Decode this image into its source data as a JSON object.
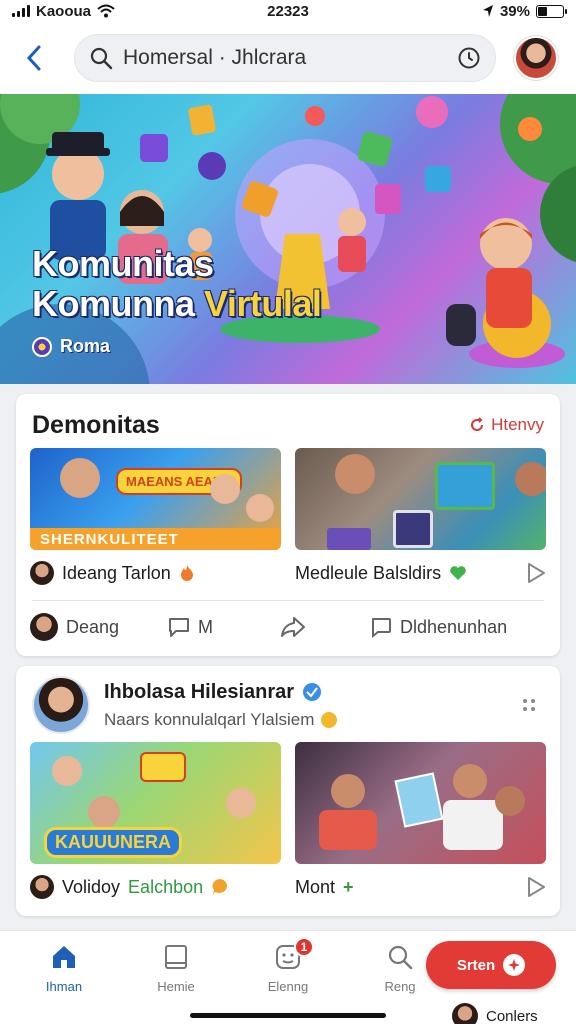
{
  "status_bar": {
    "carrier": "Kaooua",
    "time": "22323",
    "battery": "39%",
    "battery_level": 0.39
  },
  "header": {
    "search_text": "Homersal · Jhlcrara",
    "search_icon": "search-icon",
    "timer_icon": "clock-icon"
  },
  "hero": {
    "title_line1": "Komunitas",
    "title_line2_a": "Komunna ",
    "title_line2_b": "Virtulal",
    "badge": "Roma",
    "colors": {
      "accent": "#f7d43a",
      "outline": "#1b2a6b"
    }
  },
  "featured": {
    "title": "Demonitas",
    "link_label": "Htenvy",
    "thumb1_caption": "SHERNKULITEET",
    "thumb1_banner": "MAEANS AEANA",
    "items": [
      {
        "label": "Ideang Tarlon"
      },
      {
        "label": "Medleule Balsldirs"
      }
    ],
    "actions": {
      "author": "Deang",
      "comment": "M",
      "forward": "",
      "discuss": "Dldhenunhan"
    }
  },
  "post": {
    "name": "Ihbolasa Hilesianrar",
    "subtitle": "Naars konnulalqarl Ylalsiem",
    "thumb3_banner": "KAUUUNERA",
    "items": [
      {
        "label": "Volidoy",
        "tag": "Ealchbon"
      },
      {
        "label": "Mont",
        "tag": "+"
      }
    ]
  },
  "bottom_nav": {
    "items": [
      {
        "label": "Ihman",
        "icon": "home-icon"
      },
      {
        "label": "Hemie",
        "icon": "book-icon"
      },
      {
        "label": "Elenng",
        "icon": "chat-icon",
        "badge": "1"
      },
      {
        "label": "Reng",
        "icon": "search-icon"
      }
    ],
    "cta_label": "Srten",
    "footer_user": "Conlers"
  }
}
